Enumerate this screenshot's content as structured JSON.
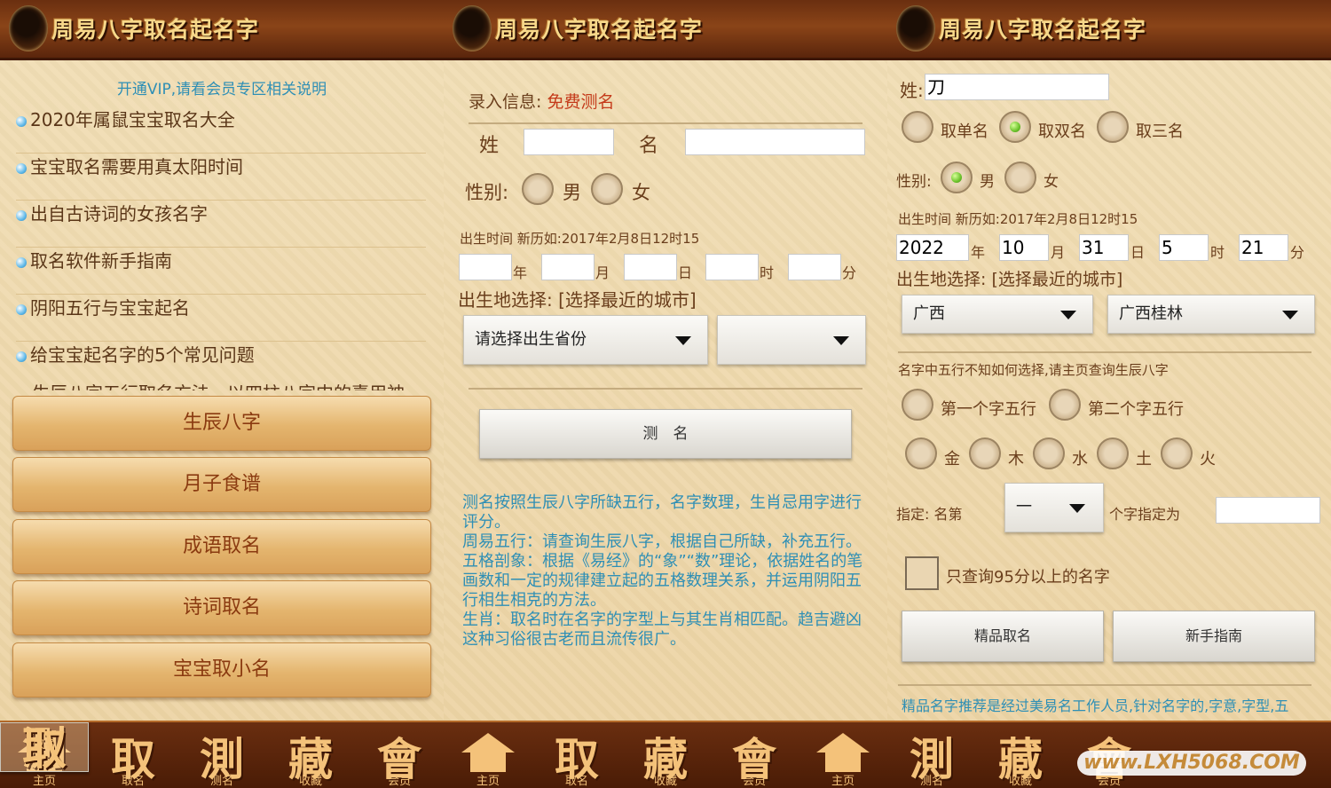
{
  "header": {
    "title": "周易八字取名起名字"
  },
  "p1": {
    "vip": "开通VIP,请看会员专区相关说明",
    "articles": [
      "2020年属鼠宝宝取名大全",
      "宝宝取名需要用真太阳时间",
      "出自古诗词的女孩名字",
      "取名软件新手指南",
      "阴阳五行与宝宝起名",
      "给宝宝起名字的5个常见问题"
    ],
    "cut": "生辰八字五行取名方法，以四柱八字中的喜用神",
    "buttons": [
      "生辰八字",
      "月子食谱",
      "成语取名",
      "诗词取名",
      "宝宝取小名"
    ]
  },
  "p2": {
    "entry_label": "录入信息:",
    "entry_value": "免费测名",
    "surname_label": "姓",
    "name_label": "名",
    "gender_label": "性别:",
    "male": "男",
    "female": "女",
    "birth_hint": "出生时间 新历如:2017年2月8日12时15",
    "units": [
      "年",
      "月",
      "日",
      "时",
      "分"
    ],
    "place_label": "出生地选择: [选择最近的城市]",
    "province_placeholder": "请选择出生省份",
    "city_value": "",
    "test_button": "测　名",
    "desc": [
      "测名按照生辰八字所缺五行，名字数理，生肖忌用字进行评分。",
      "周易五行：请查询生辰八字，根据自己所缺，补充五行。",
      "五格剖象：根据《易经》的“象”“数”理论，依据姓名的笔画数和一定的规律建立起的五格数理关系，并运用阴阳五行相生相克的方法。",
      "生肖：取名时在名字的字型上与其生肖相匹配。趋吉避凶这种习俗很古老而且流传很广。"
    ]
  },
  "p3": {
    "surname_label": "姓:",
    "surname_value": "刀",
    "name_opts": [
      "取单名",
      "取双名",
      "取三名"
    ],
    "gender_label": "性别:",
    "male": "男",
    "female": "女",
    "birth_hint": "出生时间 新历如:2017年2月8日12时15",
    "year": "2022",
    "month": "10",
    "day": "31",
    "hour": "5",
    "minute": "21",
    "units": [
      "年",
      "月",
      "日",
      "时",
      "分"
    ],
    "place_label": "出生地选择: [选择最近的城市]",
    "province": "广西",
    "city": "广西桂林",
    "wx_hint": "名字中五行不知如何选择,请主页查询生辰八字",
    "wx_first": "第一个字五行",
    "wx_second": "第二个字五行",
    "elements": [
      "金",
      "木",
      "水",
      "土",
      "火"
    ],
    "assign_label": "指定: 名第",
    "assign_value": "一",
    "assign_suffix": "个字指定为",
    "only95": "只查询95分以上的名字",
    "btn_premium": "精品取名",
    "btn_guide": "新手指南",
    "footer": "精品名字推荐是经过美易名工作人员,针对名字的,字意,字型,五"
  },
  "nav": {
    "items": [
      {
        "glyph": "",
        "label": "主页"
      },
      {
        "glyph": "取",
        "label": "取名"
      },
      {
        "glyph": "測",
        "label": "测名"
      },
      {
        "glyph": "藏",
        "label": "收藏"
      },
      {
        "glyph": "會",
        "label": "会员"
      }
    ]
  },
  "watermark": "www.LXH5068.COM"
}
